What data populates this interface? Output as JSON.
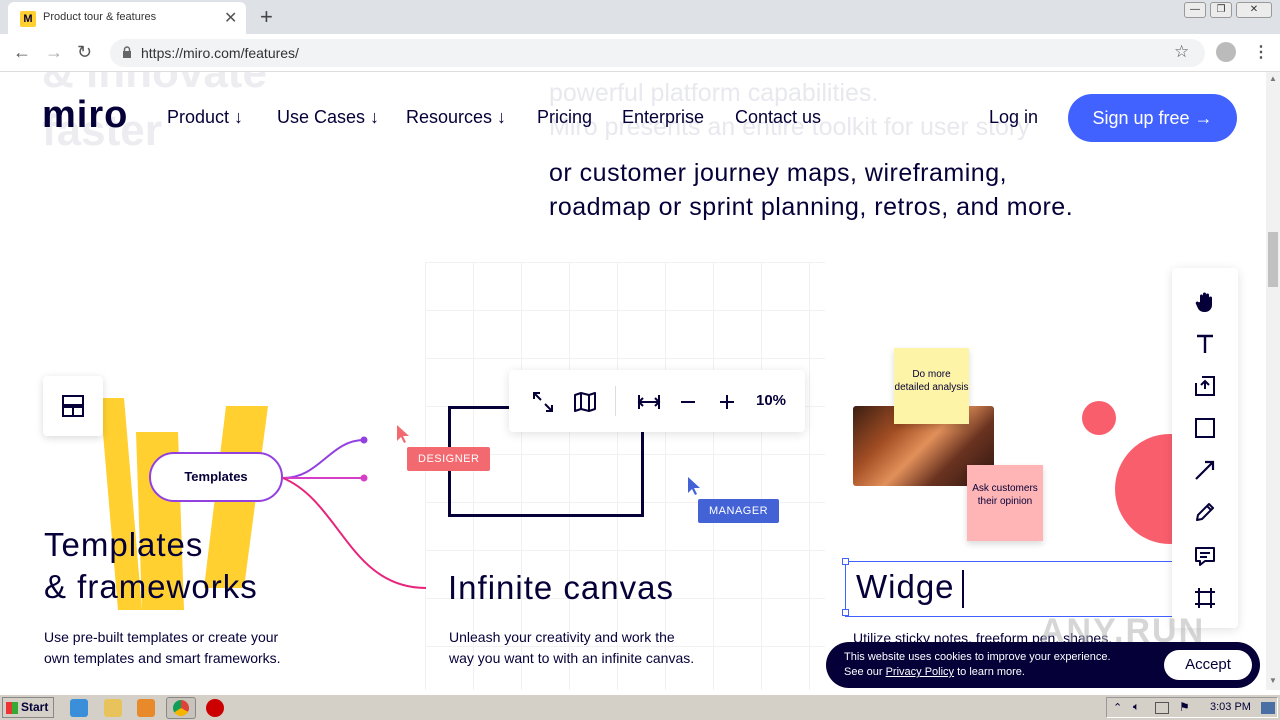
{
  "browser": {
    "tab_title": "Product tour & features",
    "favicon_letter": "M",
    "url": "https://miro.com/features/",
    "new_tab": "+",
    "tab_close": "✕",
    "back": "←",
    "forward": "→",
    "reload": "↻",
    "star": "☆",
    "menu": "⋮",
    "win_min": "—",
    "win_max": "❐",
    "win_close": "✕"
  },
  "nav": {
    "logo": "miro",
    "links": [
      "Product ↓",
      "Use Cases ↓",
      "Resources ↓",
      "Pricing",
      "Enterprise",
      "Contact us"
    ],
    "login": "Log in",
    "signup": "Sign up free →"
  },
  "hero": {
    "ghost_left_1": "& innovate",
    "ghost_left_2": "faster",
    "faded_1": "powerful platform capabilities.",
    "faded_2": "Miro presents an entire toolkit for user story",
    "line_1": "or customer journey maps, wireframing,",
    "line_2": "roadmap or sprint planning, retros, and more."
  },
  "features": {
    "templates": {
      "pill": "Templates",
      "heading_1": "Templates",
      "heading_2": "& frameworks",
      "body_1": "Use pre-built templates or create your",
      "body_2": "own templates and smart frameworks."
    },
    "canvas": {
      "heading": "Infinite canvas",
      "body_1": "Unleash your creativity and work the",
      "body_2": "way you want to with an infinite canvas.",
      "tag_designer": "DESIGNER",
      "tag_manager": "MANAGER",
      "zoom_level": "10%"
    },
    "widgets": {
      "sticky_1": "Do more detailed analysis",
      "sticky_2": "Ask customers their opinion",
      "typing": "Widge",
      "body_1": "Utilize sticky notes, freeform pen, shapes,"
    }
  },
  "cookie": {
    "line_1": "This website uses cookies to improve your experience.",
    "line_2_pre": "See our ",
    "link": "Privacy Policy",
    "line_2_post": " to learn more.",
    "accept": "Accept"
  },
  "watermark": "ANY.RUN",
  "taskbar": {
    "start": "Start",
    "clock": "3:03 PM"
  },
  "colors": {
    "brand_blue": "#4262ff",
    "navy": "#050038",
    "designer_tag": "#f26a6f",
    "manager_tag": "#4262d6",
    "sticky_yellow": "#fef4a8",
    "sticky_pink": "#ffb5b5",
    "coral": "#f95e6d",
    "yellow_shape": "#ffd02f"
  }
}
